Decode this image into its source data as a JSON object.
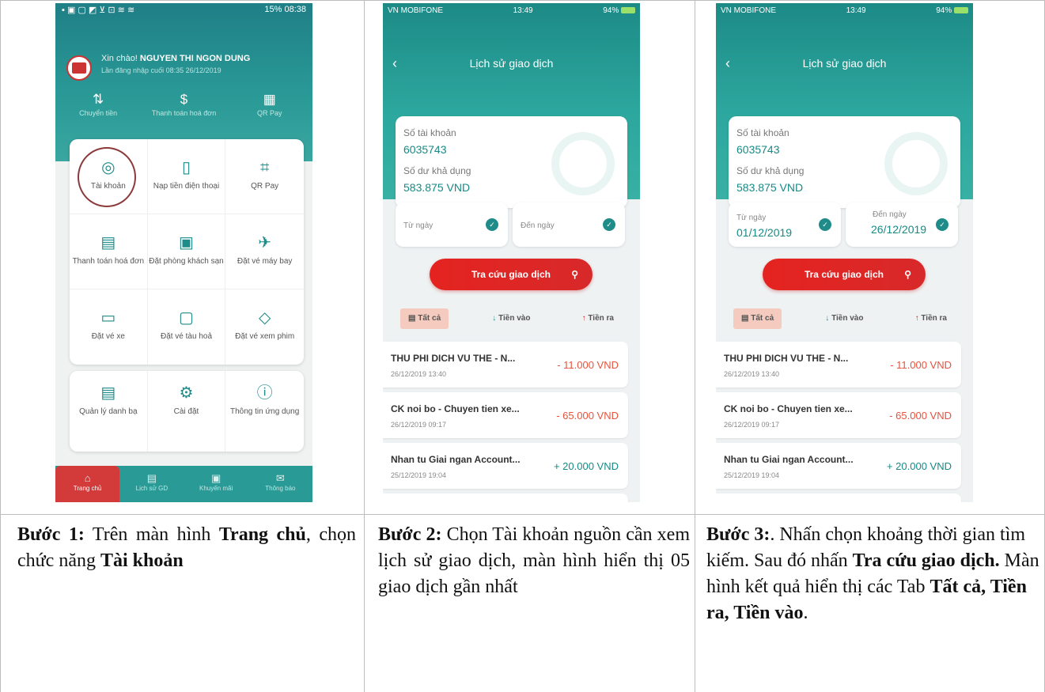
{
  "phone1": {
    "status_left": "▪ ▣ ▢ ◩ ⊻ ⊡ ≋ ≋",
    "status_right": "15%  08:38",
    "greeting": "Xin chào! ",
    "user_name": "NGUYEN THI NGON DUNG",
    "last_login": "Lần đăng nhập cuối 08:35 26/12/2019",
    "quick": [
      {
        "label": "Chuyển tiền",
        "icon": "transfer-icon",
        "glyph": "⇅"
      },
      {
        "label": "Thanh toán hoá đơn",
        "icon": "bill-icon",
        "glyph": "$"
      },
      {
        "label": "QR Pay",
        "icon": "qr-icon",
        "glyph": "▦"
      }
    ],
    "menu": [
      {
        "label": "Tài khoản",
        "icon": "account-icon",
        "glyph": "◎"
      },
      {
        "label": "Nạp tiền điện thoại",
        "icon": "phone-topup-icon",
        "glyph": "▯"
      },
      {
        "label": "QR Pay",
        "icon": "qr-scan-icon",
        "glyph": "⌗"
      },
      {
        "label": "Thanh toán hoá đơn",
        "icon": "invoice-icon",
        "glyph": "▤"
      },
      {
        "label": "Đặt phòng khách sạn",
        "icon": "hotel-icon",
        "glyph": "▣"
      },
      {
        "label": "Đặt vé máy bay",
        "icon": "plane-icon",
        "glyph": "✈"
      },
      {
        "label": "Đặt vé xe",
        "icon": "bus-icon",
        "glyph": "▭"
      },
      {
        "label": "Đặt vé tàu hoả",
        "icon": "train-icon",
        "glyph": "▢"
      },
      {
        "label": "Đặt vé xem phim",
        "icon": "ticket-icon",
        "glyph": "◇"
      }
    ],
    "menu2": [
      {
        "label": "Quản lý danh bạ",
        "icon": "contacts-icon",
        "glyph": "▤"
      },
      {
        "label": "Cài đặt",
        "icon": "settings-icon",
        "glyph": "⚙"
      },
      {
        "label": "Thông tin ứng dụng",
        "icon": "info-icon",
        "glyph": "ⓘ"
      }
    ],
    "tabbar": [
      {
        "label": "Trang chủ",
        "icon": "home-icon",
        "glyph": "⌂"
      },
      {
        "label": "Lịch sử GD",
        "icon": "history-icon",
        "glyph": "▤"
      },
      {
        "label": "Khuyến mãi",
        "icon": "promo-icon",
        "glyph": "▣"
      },
      {
        "label": "Thông báo",
        "icon": "mail-icon",
        "glyph": "✉"
      }
    ]
  },
  "phone2": {
    "carrier": "VN MOBIFONE",
    "time": "13:49",
    "battery": "94%",
    "title": "Lịch sử giao dịch",
    "account_label": "Số tài khoản",
    "account_number": "6035743",
    "balance_label": "Số dư khả dụng",
    "balance": "583.875 VND",
    "from_label": "Từ ngày",
    "to_label": "Đến ngày",
    "search_button": "Tra cứu giao dịch",
    "tabs": [
      "Tất cả",
      "Tiền vào",
      "Tiền ra"
    ],
    "transactions": [
      {
        "name": "THU PHI DICH VU THE - N...",
        "time": "26/12/2019 13:40",
        "amount": "- 11.000 VND",
        "sign": "neg"
      },
      {
        "name": "CK noi bo - Chuyen tien xe...",
        "time": "26/12/2019 09:17",
        "amount": "- 65.000 VND",
        "sign": "neg"
      },
      {
        "name": "Nhan tu Giai ngan Account...",
        "time": "25/12/2019 19:04",
        "amount": "+ 20.000 VND",
        "sign": "pos"
      }
    ]
  },
  "phone3": {
    "carrier": "VN MOBIFONE",
    "time": "13:49",
    "battery": "94%",
    "title": "Lịch sử giao dịch",
    "account_label": "Số tài khoản",
    "account_number": "6035743",
    "balance_label": "Số dư khả dụng",
    "balance": "583.875 VND",
    "from_label": "Từ ngày",
    "from_value": "01/12/2019",
    "to_label": "Đến ngày",
    "to_value": "26/12/2019",
    "search_button": "Tra cứu giao dịch",
    "tabs": [
      "Tất cả",
      "Tiền vào",
      "Tiền ra"
    ],
    "transactions": [
      {
        "name": "THU PHI DICH VU THE - N...",
        "time": "26/12/2019 13:40",
        "amount": "- 11.000 VND",
        "sign": "neg"
      },
      {
        "name": "CK noi bo - Chuyen tien xe...",
        "time": "26/12/2019 09:17",
        "amount": "- 65.000 VND",
        "sign": "neg"
      },
      {
        "name": "Nhan tu Giai ngan Account...",
        "time": "25/12/2019 19:04",
        "amount": "+ 20.000 VND",
        "sign": "pos"
      }
    ]
  },
  "captions": {
    "step1_label": "Bước 1:",
    "step1_a": " Trên màn hình ",
    "step1_b": "Trang chủ",
    "step1_c": ", chọn chức năng ",
    "step1_d": "Tài khoản",
    "step2_label": "Bước 2:",
    "step2_text": " Chọn Tài khoản nguồn cần xem lịch sử giao dịch, màn hình hiển thị 05 giao dịch gần nhất",
    "step3_label": "Bước 3:",
    "step3_a": ". Nhấn chọn khoảng thời gian tìm kiếm. Sau đó nhấn ",
    "step3_b": "Tra cứu giao dịch.",
    "step3_c": " Màn hình kết quả hiển thị các Tab ",
    "step3_d": "Tất cả, Tiền ra, Tiền vào",
    "step3_e": "."
  }
}
